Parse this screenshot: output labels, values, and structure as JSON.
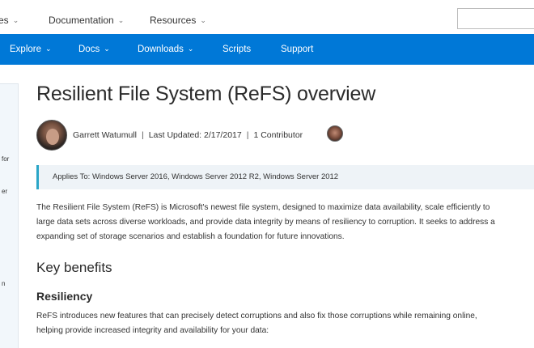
{
  "topnav": {
    "items": [
      {
        "label": "es"
      },
      {
        "label": "Documentation"
      },
      {
        "label": "Resources"
      }
    ]
  },
  "bluenav": {
    "items": [
      {
        "label": "Explore"
      },
      {
        "label": "Docs"
      },
      {
        "label": "Downloads"
      },
      {
        "label": "Scripts"
      },
      {
        "label": "Support"
      }
    ]
  },
  "sidebar": {
    "collapse_glyph": "‹",
    "fragments": [
      "for",
      "er",
      "n"
    ]
  },
  "article": {
    "title": "Resilient File System (ReFS) overview",
    "author": "Garrett Watumull",
    "last_updated": "Last Updated: 2/17/2017",
    "contributors": "1 Contributor",
    "applies_to": "Applies To: Windows Server 2016, Windows Server 2012 R2, Windows Server 2012",
    "intro_lines": [
      "The Resilient File System (ReFS) is Microsoft's newest file system, designed to maximize data availability, scale efficiently to",
      "large data sets across diverse workloads, and provide data integrity by means of resiliency to corruption. It seeks to address a",
      "expanding set of storage scenarios and establish a foundation for future innovations."
    ],
    "key_benefits_heading": "Key benefits",
    "resiliency_heading": "Resiliency",
    "resiliency_lines": [
      "ReFS introduces new features that can precisely detect corruptions and also fix those corruptions while remaining online,",
      "helping provide increased integrity and availability for your data:"
    ]
  },
  "colors": {
    "brand_blue": "#0078d7",
    "applies_border": "#2aa6c7"
  },
  "icons": {
    "chevron": "chevron-down-icon",
    "collapse": "chevron-left-icon"
  }
}
